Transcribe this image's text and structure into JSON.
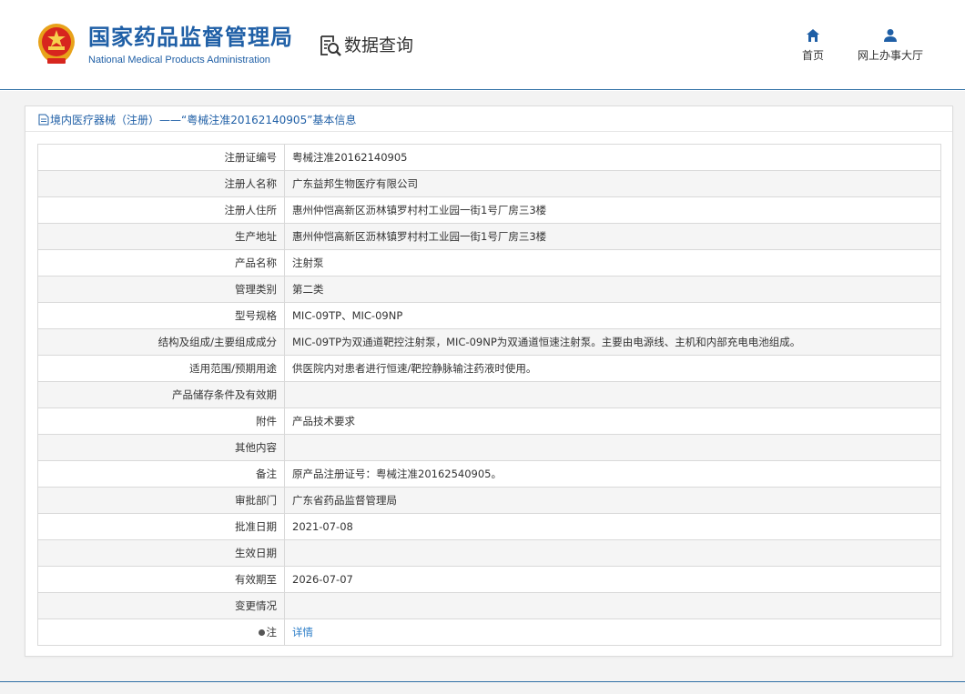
{
  "header": {
    "brand_cn": "国家药品监督管理局",
    "brand_en": "National Medical Products Administration",
    "query_label": "数据查询",
    "nav": [
      {
        "label": "首页",
        "icon": "home-icon"
      },
      {
        "label": "网上办事大厅",
        "icon": "user-icon"
      }
    ],
    "brand_color": "#1f5fa6"
  },
  "panel": {
    "title": "境内医疗器械（注册）——“粤械注准20162140905”基本信息"
  },
  "rows": [
    {
      "label": "注册证编号",
      "value": "粤械注准20162140905"
    },
    {
      "label": "注册人名称",
      "value": "广东益邦生物医疗有限公司"
    },
    {
      "label": "注册人住所",
      "value": "惠州仲恺高新区沥林镇罗村村工业园一街1号厂房三3楼"
    },
    {
      "label": "生产地址",
      "value": "惠州仲恺高新区沥林镇罗村村工业园一街1号厂房三3楼"
    },
    {
      "label": "产品名称",
      "value": "注射泵"
    },
    {
      "label": "管理类别",
      "value": "第二类"
    },
    {
      "label": "型号规格",
      "value": "MIC-09TP、MIC-09NP"
    },
    {
      "label": "结构及组成/主要组成成分",
      "value": "MIC-09TP为双通道靶控注射泵，MIC-09NP为双通道恒速注射泵。主要由电源线、主机和内部充电电池组成。"
    },
    {
      "label": "适用范围/预期用途",
      "value": "供医院内对患者进行恒速/靶控静脉输注药液时使用。"
    },
    {
      "label": "产品储存条件及有效期",
      "value": ""
    },
    {
      "label": "附件",
      "value": "产品技术要求"
    },
    {
      "label": "其他内容",
      "value": ""
    },
    {
      "label": "备注",
      "value": "原产品注册证号：粤械注准20162540905。"
    },
    {
      "label": "审批部门",
      "value": "广东省药品监督管理局"
    },
    {
      "label": "批准日期",
      "value": "2021-07-08"
    },
    {
      "label": "生效日期",
      "value": ""
    },
    {
      "label": "有效期至",
      "value": "2026-07-07"
    },
    {
      "label": "变更情况",
      "value": ""
    }
  ],
  "note_row": {
    "label": "注",
    "link": "详情"
  }
}
